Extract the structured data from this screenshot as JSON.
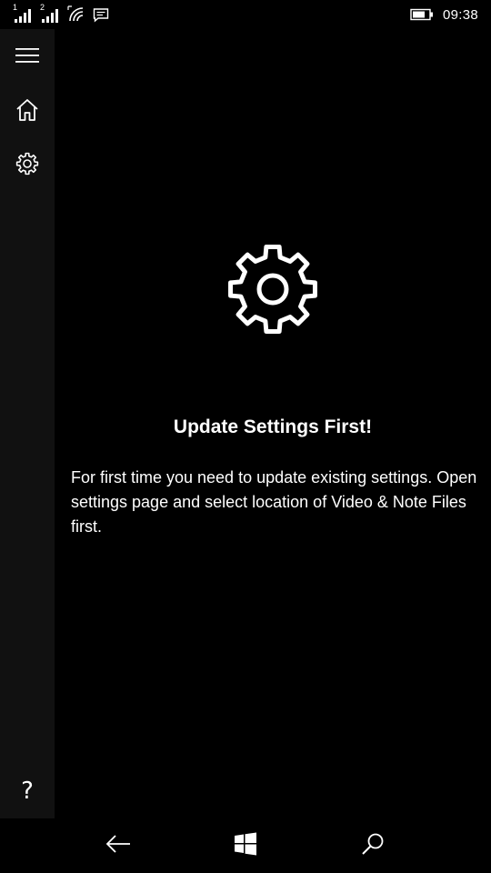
{
  "status_bar": {
    "sim1_label": "1",
    "sim2_label": "2",
    "time": "09:38",
    "icons": [
      "signal-icon",
      "signal-icon",
      "wifi-icon",
      "message-icon",
      "battery-icon"
    ]
  },
  "sidebar": {
    "items": [
      {
        "icon": "hamburger-menu-icon"
      },
      {
        "icon": "home-icon"
      },
      {
        "icon": "settings-gear-icon"
      }
    ],
    "help_label": "?"
  },
  "main": {
    "hero_icon": "gear-icon",
    "title": "Update Settings First!",
    "message": "For first time you need to update existing settings. Open settings page and select location of Video & Note Files first."
  },
  "nav_bar": {
    "icons": [
      "back-arrow-icon",
      "windows-start-icon",
      "search-icon"
    ]
  },
  "colors": {
    "background": "#000000",
    "sidebar": "#111111",
    "text": "#ffffff"
  }
}
